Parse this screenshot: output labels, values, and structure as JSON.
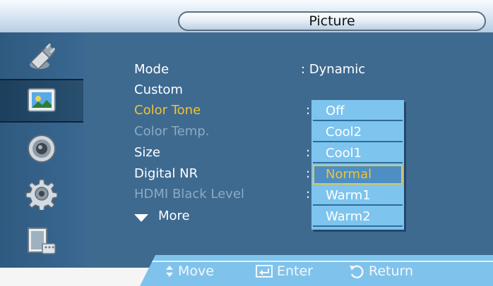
{
  "header": {
    "title": "Picture"
  },
  "sidebar": {
    "items": [
      {
        "icon": "input-plug-icon"
      },
      {
        "icon": "picture-icon",
        "selected": true
      },
      {
        "icon": "sound-speaker-icon"
      },
      {
        "icon": "setup-gear-icon"
      },
      {
        "icon": "multi-control-icon"
      }
    ]
  },
  "menu": {
    "items": [
      {
        "label": "Mode",
        "value": ": Dynamic"
      },
      {
        "label": "Custom",
        "value": ""
      },
      {
        "label": "Color Tone",
        "value": ":"
      },
      {
        "label": "Color Temp.",
        "value": ""
      },
      {
        "label": "Size",
        "value": ":"
      },
      {
        "label": "Digital NR",
        "value": ":"
      },
      {
        "label": "HDMI Black Level",
        "value": ":"
      }
    ],
    "more_label": "More"
  },
  "dropdown": {
    "options": [
      "Off",
      "Cool2",
      "Cool1",
      "Normal",
      "Warm1",
      "Warm2"
    ],
    "selected": "Normal"
  },
  "footer": {
    "move": "Move",
    "enter": "Enter",
    "return": "Return"
  },
  "colors": {
    "highlight": "#f1c232",
    "menu_bg": "#3e6a90",
    "dropdown_bg": "#7dc4ee"
  }
}
